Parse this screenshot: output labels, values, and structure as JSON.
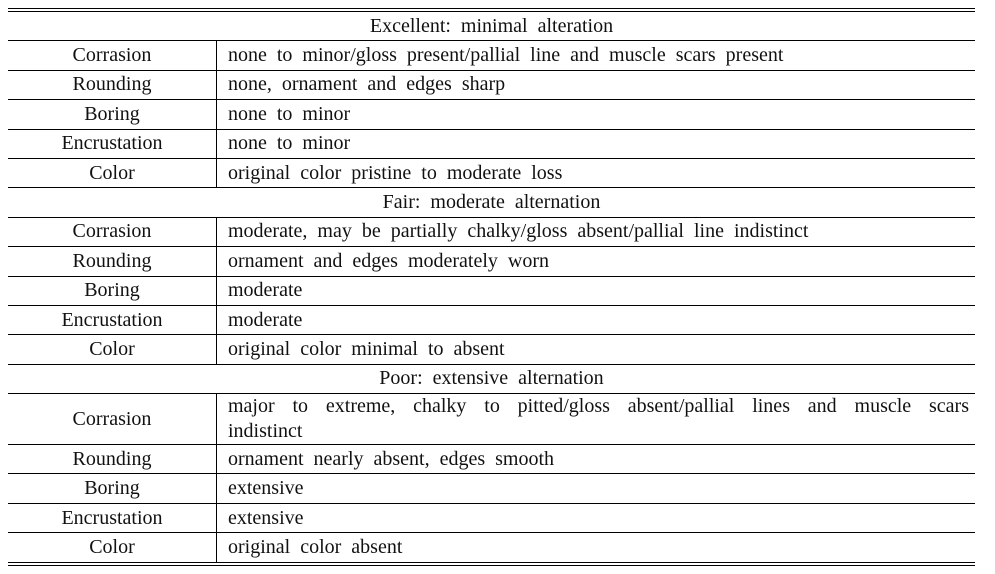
{
  "sections": [
    {
      "title": "Excellent: minimal alteration",
      "rows": [
        {
          "criterion": "Corrasion",
          "description": "none to minor/gloss present/pallial line and muscle scars present"
        },
        {
          "criterion": "Rounding",
          "description": "none, ornament and edges sharp"
        },
        {
          "criterion": "Boring",
          "description": "none to minor"
        },
        {
          "criterion": "Encrustation",
          "description": "none to minor"
        },
        {
          "criterion": "Color",
          "description": "original color pristine to moderate loss"
        }
      ]
    },
    {
      "title": "Fair: moderate alternation",
      "rows": [
        {
          "criterion": "Corrasion",
          "description": "moderate, may be partially chalky/gloss absent/pallial line indistinct"
        },
        {
          "criterion": "Rounding",
          "description": "ornament and edges moderately worn"
        },
        {
          "criterion": "Boring",
          "description": "moderate"
        },
        {
          "criterion": "Encrustation",
          "description": "moderate"
        },
        {
          "criterion": "Color",
          "description": "original color minimal to absent"
        }
      ]
    },
    {
      "title": "Poor: extensive alternation",
      "rows": [
        {
          "criterion": "Corrasion",
          "description": "major to extreme, chalky to pitted/gloss absent/pallial lines and muscle scars indistinct"
        },
        {
          "criterion": "Rounding",
          "description": "ornament nearly absent, edges smooth"
        },
        {
          "criterion": "Boring",
          "description": "extensive"
        },
        {
          "criterion": "Encrustation",
          "description": "extensive"
        },
        {
          "criterion": "Color",
          "description": "original color absent"
        }
      ]
    }
  ]
}
